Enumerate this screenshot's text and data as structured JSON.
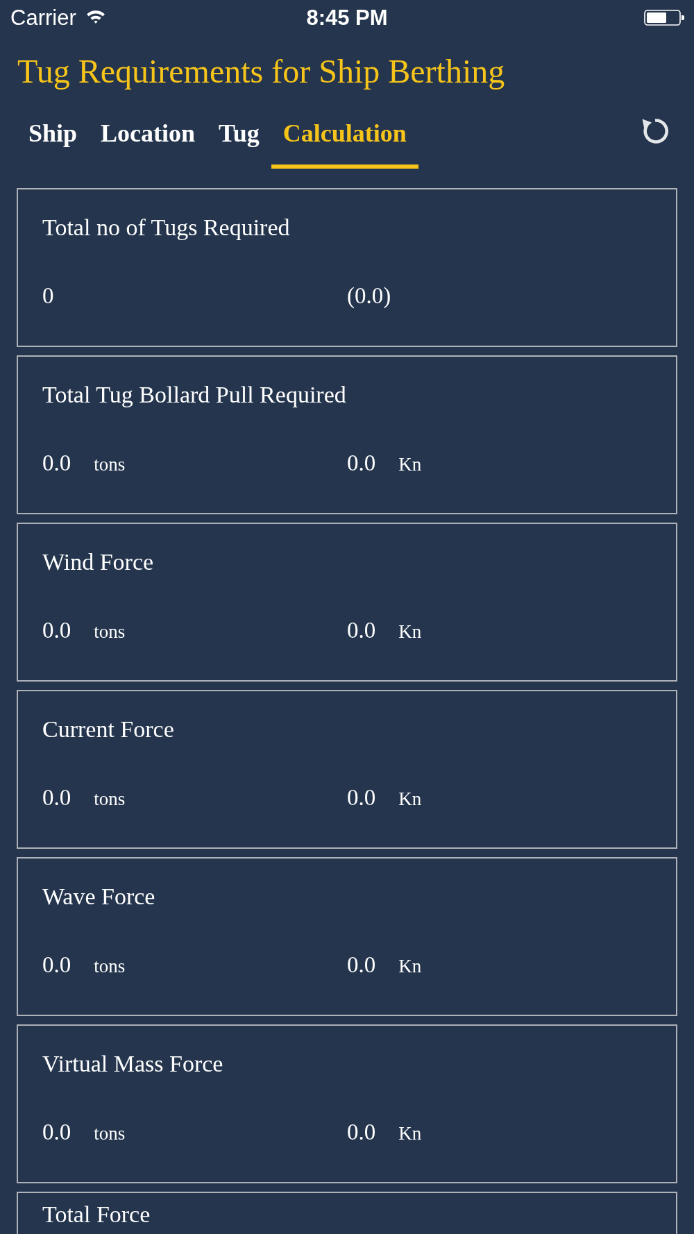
{
  "status_bar": {
    "carrier": "Carrier",
    "time": "8:45 PM"
  },
  "header": {
    "title": "Tug Requirements for Ship Berthing"
  },
  "tabs": [
    {
      "label": "Ship",
      "selected": false
    },
    {
      "label": "Location",
      "selected": false
    },
    {
      "label": "Tug",
      "selected": false
    },
    {
      "label": "Calculation",
      "selected": true
    }
  ],
  "results": [
    {
      "title": "Total no of Tugs Required",
      "values": [
        {
          "value": "0"
        },
        {
          "value": "(0.0)"
        }
      ]
    },
    {
      "title": "Total Tug Bollard Pull Required",
      "values": [
        {
          "value": "0.0",
          "unit": "tons"
        },
        {
          "value": "0.0",
          "unit": "Kn"
        }
      ]
    },
    {
      "title": "Wind Force",
      "values": [
        {
          "value": "0.0",
          "unit": "tons"
        },
        {
          "value": "0.0",
          "unit": "Kn"
        }
      ]
    },
    {
      "title": "Current Force",
      "values": [
        {
          "value": "0.0",
          "unit": "tons"
        },
        {
          "value": "0.0",
          "unit": "Kn"
        }
      ]
    },
    {
      "title": "Wave Force",
      "values": [
        {
          "value": "0.0",
          "unit": "tons"
        },
        {
          "value": "0.0",
          "unit": "Kn"
        }
      ]
    },
    {
      "title": "Virtual Mass Force",
      "values": [
        {
          "value": "0.0",
          "unit": "tons"
        },
        {
          "value": "0.0",
          "unit": "Kn"
        }
      ]
    },
    {
      "title": "Total Force"
    }
  ]
}
